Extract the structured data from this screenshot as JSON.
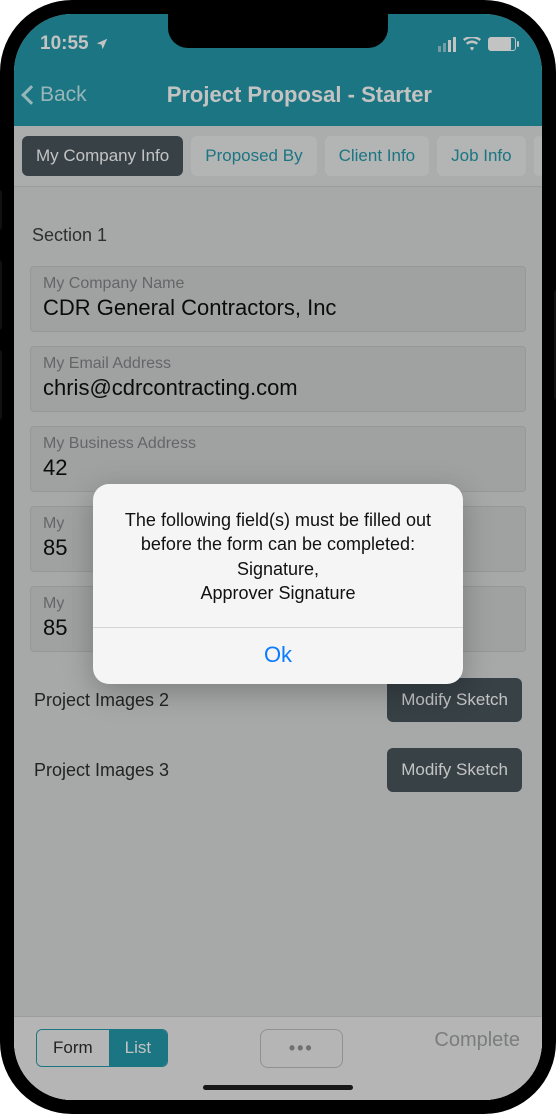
{
  "status": {
    "time": "10:55"
  },
  "nav": {
    "back": "Back",
    "title": "Project Proposal - Starter"
  },
  "tabs": {
    "items": [
      {
        "label": "My Company Info"
      },
      {
        "label": "Proposed By"
      },
      {
        "label": "Client Info"
      },
      {
        "label": "Job Info"
      }
    ]
  },
  "section": {
    "title": "Section 1"
  },
  "fields": [
    {
      "label": "My Company Name",
      "value": "CDR General Contractors, Inc"
    },
    {
      "label": "My Email Address",
      "value": "chris@cdrcontracting.com"
    },
    {
      "label": "My Business Address",
      "value": "42"
    },
    {
      "label": "My",
      "value": "85"
    },
    {
      "label": "My",
      "value": "85"
    }
  ],
  "rows": [
    {
      "label": "Project Images 2",
      "button": "Modify Sketch"
    },
    {
      "label": "Project Images 3",
      "button": "Modify Sketch"
    }
  ],
  "bottom": {
    "form": "Form",
    "list": "List",
    "more": "•••",
    "complete": "Complete"
  },
  "alert": {
    "line1": "The following field(s) must be filled out",
    "line2": "before the form can be completed:",
    "line3": "Signature,",
    "line4": "Approver Signature",
    "ok": "Ok"
  }
}
